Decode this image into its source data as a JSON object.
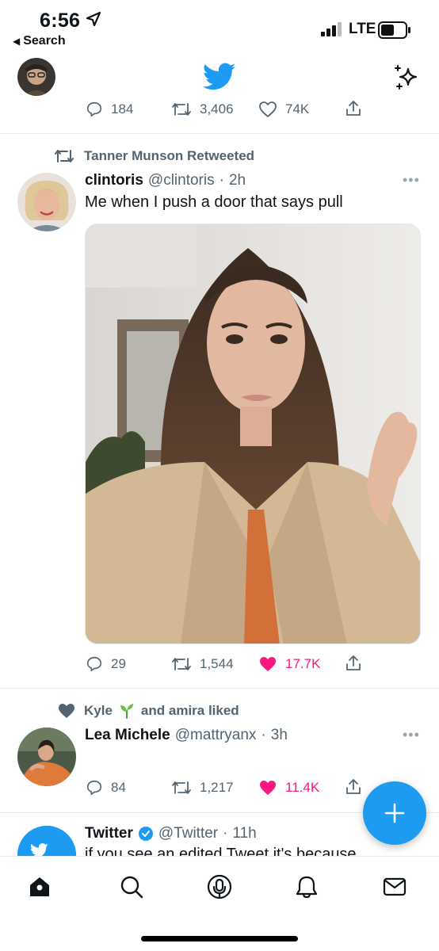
{
  "status_bar": {
    "time": "6:56",
    "back_label": "Search",
    "network": "LTE"
  },
  "colors": {
    "brand": "#1d9bf0",
    "like": "#f91880",
    "muted": "#536471"
  },
  "previous_tweet": {
    "replies": "184",
    "retweets": "3,406",
    "likes": "74K"
  },
  "tweet1": {
    "context": "Tanner Munson Retweeted",
    "name": "clintoris",
    "handle": "@clintoris",
    "time": "2h",
    "text": "Me when I push a door that says pull",
    "replies": "29",
    "retweets": "1,544",
    "likes": "17.7K"
  },
  "tweet2": {
    "context_name1": "Kyle",
    "context_rest": "and amira liked",
    "name": "Lea Michele",
    "handle": "@mattryanx",
    "time": "3h",
    "replies": "84",
    "retweets": "1,217",
    "likes": "11.4K"
  },
  "tweet3": {
    "name": "Twitter",
    "handle": "@Twitter",
    "time": "11h",
    "text": "if you see an edited Tweet it's because"
  },
  "tabs": [
    "home-icon",
    "search-icon",
    "spaces-icon",
    "notifications-icon",
    "messages-icon"
  ]
}
